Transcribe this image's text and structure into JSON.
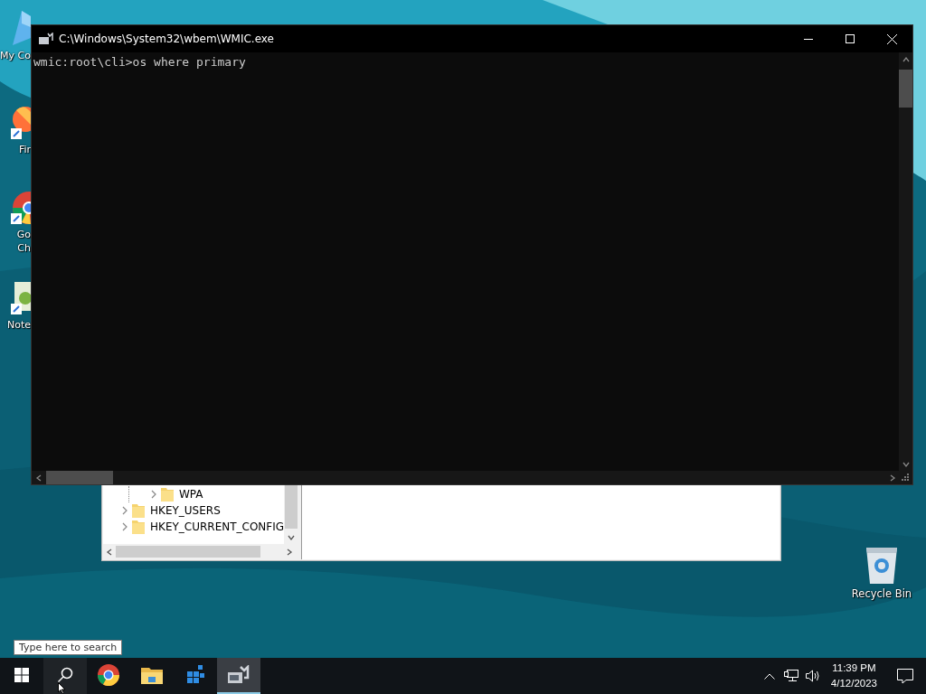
{
  "desktop_icons": [
    {
      "kind": "computer",
      "lines": [
        "My Co"
      ]
    },
    {
      "kind": "firefox",
      "lines": [
        "Fir"
      ]
    },
    {
      "kind": "chrome",
      "lines": [
        "Go",
        "Ch"
      ]
    },
    {
      "kind": "notepad",
      "lines": [
        "Note"
      ]
    }
  ],
  "recycle_bin": {
    "label": "Recycle Bin"
  },
  "console_window": {
    "title": "C:\\Windows\\System32\\wbem\\WMIC.exe",
    "lines": [
      "wmic:root\\cli>os where primary"
    ]
  },
  "registry_window": {
    "tree": [
      {
        "children": [
          {
            "label": "WPA",
            "expanded": false
          }
        ]
      },
      {
        "label": "HKEY_USERS",
        "expanded": false
      },
      {
        "label": "HKEY_CURRENT_CONFIG",
        "expanded": false
      }
    ]
  },
  "search_tooltip": "Type here to search",
  "taskbar": {
    "apps": [
      {
        "kind": "search",
        "selected": false
      },
      {
        "kind": "chrome",
        "selected": false
      },
      {
        "kind": "explorer",
        "selected": false
      },
      {
        "kind": "regedit",
        "selected": false
      },
      {
        "kind": "wmic",
        "selected": true
      }
    ],
    "time": "11:39 PM",
    "date": "4/12/2023"
  }
}
